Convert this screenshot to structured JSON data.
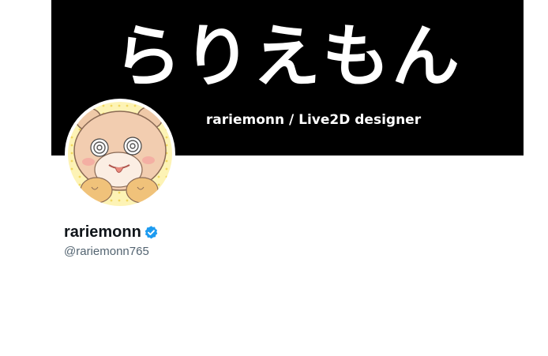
{
  "banner": {
    "title": "らりえもん",
    "subtitle": "rariemonn / Live2D designer"
  },
  "avatar": {
    "icon": "bear-avatar-icon"
  },
  "profile": {
    "display_name": "rariemonn",
    "handle": "@rariemonn765",
    "verified_icon": "verified-badge-icon"
  },
  "colors": {
    "banner_bg": "#000000",
    "name_text": "#0f1419",
    "handle_text": "#536471",
    "verified": "#1d9bf0"
  }
}
